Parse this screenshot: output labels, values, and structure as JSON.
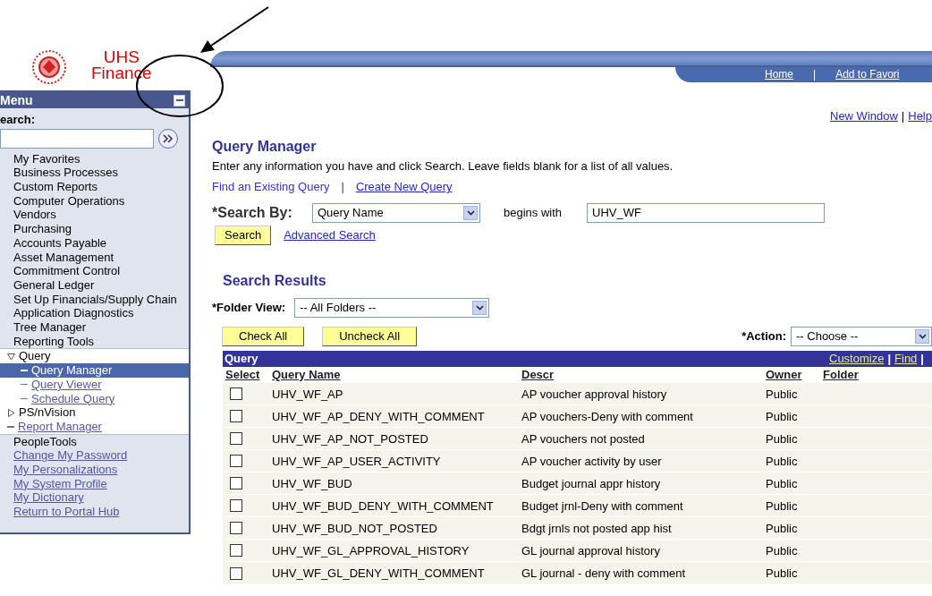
{
  "logo": {
    "line1": "UHS",
    "line2": "Finance"
  },
  "header_links": [
    {
      "label": "Home"
    },
    {
      "label": "Add to Favori"
    }
  ],
  "header_separator": "|",
  "menu": {
    "title": "Menu",
    "search_label": "earch:",
    "items": [
      {
        "label": "My Favorites",
        "kind": "folder"
      },
      {
        "label": "Business Processes",
        "kind": "folder"
      },
      {
        "label": "Custom Reports",
        "kind": "folder"
      },
      {
        "label": "Computer Operations",
        "kind": "folder"
      },
      {
        "label": "Vendors",
        "kind": "folder"
      },
      {
        "label": "Purchasing",
        "kind": "folder"
      },
      {
        "label": "Accounts Payable",
        "kind": "folder"
      },
      {
        "label": "Asset Management",
        "kind": "folder"
      },
      {
        "label": "Commitment Control",
        "kind": "folder"
      },
      {
        "label": "General Ledger",
        "kind": "folder"
      },
      {
        "label": "Set Up Financials/Supply Chain",
        "kind": "folder"
      },
      {
        "label": "Application Diagnostics",
        "kind": "folder"
      },
      {
        "label": "Tree Manager",
        "kind": "folder"
      },
      {
        "label": "Reporting Tools",
        "kind": "folder",
        "expanded": true,
        "children": [
          {
            "label": "Query",
            "kind": "folder",
            "expanded": true,
            "children": [
              {
                "label": "Query Manager",
                "kind": "link",
                "selected": true
              },
              {
                "label": "Query Viewer",
                "kind": "link",
                "selected": false
              },
              {
                "label": "Schedule Query",
                "kind": "link",
                "selected": false
              }
            ]
          },
          {
            "label": "PS/nVision",
            "kind": "folder",
            "expanded": false
          },
          {
            "label": "Report Manager",
            "kind": "link"
          }
        ]
      },
      {
        "label": "PeopleTools",
        "kind": "folder"
      },
      {
        "label": "Change My Password",
        "kind": "link"
      },
      {
        "label": "My Personalizations",
        "kind": "link"
      },
      {
        "label": "My System Profile",
        "kind": "link"
      },
      {
        "label": "My Dictionary",
        "kind": "link"
      },
      {
        "label": "Return to Portal Hub",
        "kind": "link"
      }
    ]
  },
  "top_links": [
    "New Window",
    "Help"
  ],
  "top_separator": "|",
  "page": {
    "title": "Query Manager",
    "instructions": "Enter any information you have and click Search. Leave fields blank for a list of all values.",
    "tabs": [
      {
        "label": "Find an Existing Query",
        "selected": true
      },
      {
        "label": "Create New Query",
        "selected": false
      }
    ],
    "tab_separator": "|",
    "search": {
      "label": "*Search By:",
      "field": "Query Name",
      "operator": "begins with",
      "value": "UHV_WF",
      "button": "Search",
      "advanced": "Advanced Search"
    }
  },
  "results": {
    "title": "Search Results",
    "folder_label": "*Folder View:",
    "folder_value": "-- All Folders --",
    "buttons": [
      "Check All",
      "Uncheck All"
    ],
    "action_label": "*Action:",
    "action_value": "-- Choose --",
    "grid_title": "Query",
    "grid_links": [
      "Customize",
      "Find"
    ],
    "grid_link_separators": [
      "|",
      "|"
    ],
    "columns": [
      "Select",
      "Query Name",
      "Descr",
      "Owner",
      "Folder"
    ],
    "rows": [
      {
        "checked": false,
        "name": "UHV_WF_AP",
        "descr": "AP voucher approval history",
        "owner": "Public"
      },
      {
        "checked": false,
        "name": "UHV_WF_AP_DENY_WITH_COMMENT",
        "descr": "AP vouchers-Deny with comment",
        "owner": "Public"
      },
      {
        "checked": false,
        "name": "UHV_WF_AP_NOT_POSTED",
        "descr": "AP vouchers not posted",
        "owner": "Public"
      },
      {
        "checked": false,
        "name": "UHV_WF_AP_USER_ACTIVITY",
        "descr": "AP voucher activity by user",
        "owner": "Public"
      },
      {
        "checked": false,
        "name": "UHV_WF_BUD",
        "descr": "Budget journal appr history",
        "owner": "Public"
      },
      {
        "checked": false,
        "name": "UHV_WF_BUD_DENY_WITH_COMMENT",
        "descr": "Budget jrnl-Deny with comment",
        "owner": "Public"
      },
      {
        "checked": false,
        "name": "UHV_WF_BUD_NOT_POSTED",
        "descr": "Bdgt jrnls not posted app hist",
        "owner": "Public"
      },
      {
        "checked": false,
        "name": "UHV_WF_GL_APPROVAL_HISTORY",
        "descr": "GL journal approval history",
        "owner": "Public"
      },
      {
        "checked": false,
        "name": "UHV_WF_GL_DENY_WITH_COMMENT",
        "descr": "GL journal - deny with comment",
        "owner": "Public"
      }
    ]
  }
}
